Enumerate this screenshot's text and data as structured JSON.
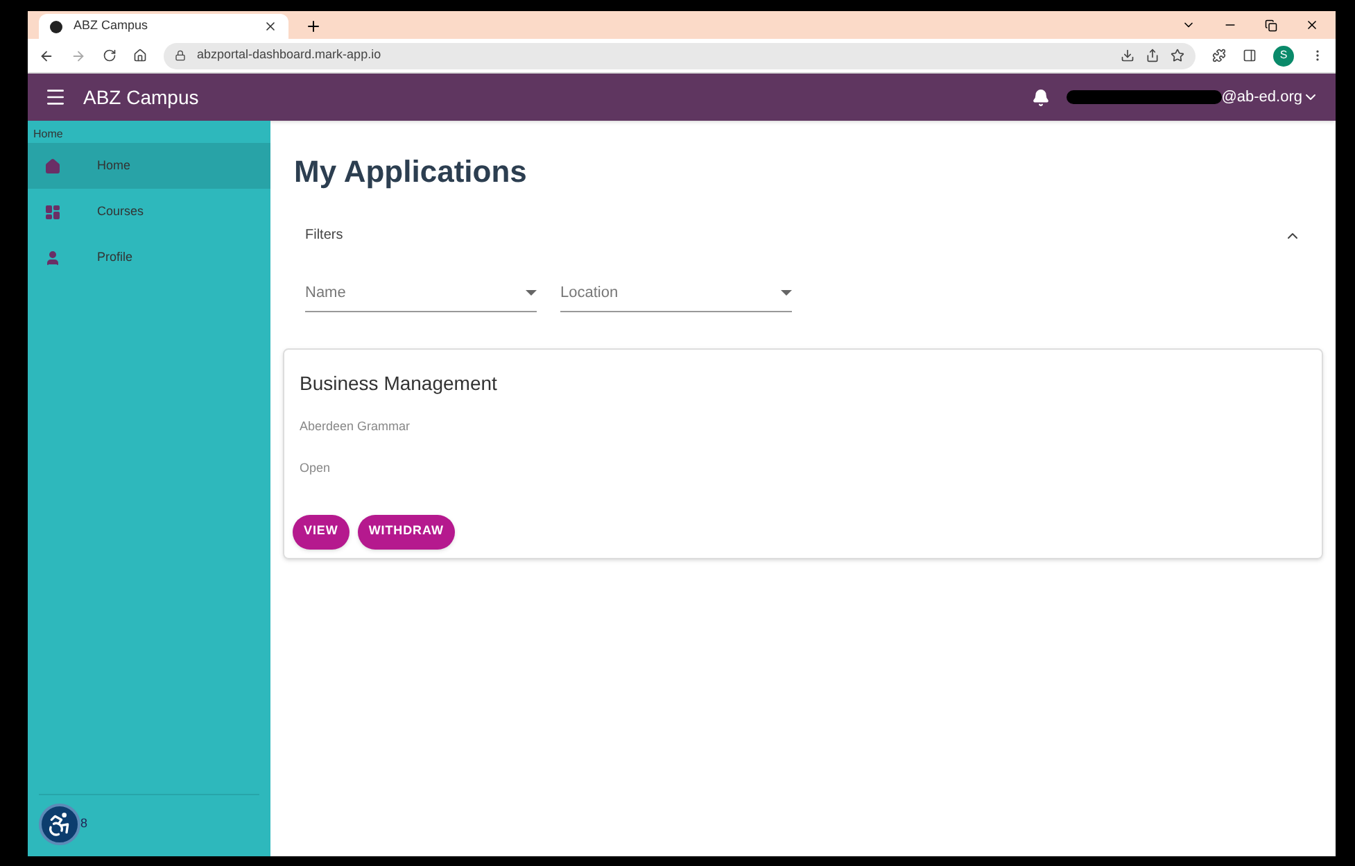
{
  "browser": {
    "tab_title": "ABZ Campus",
    "url": "abzportal-dashboard.mark-app.io",
    "profile_initial": "S"
  },
  "app_bar": {
    "title": "ABZ Campus",
    "user_email": "@ab-ed.org"
  },
  "sidebar": {
    "breadcrumb": "Home",
    "items": [
      {
        "label": "Home",
        "selected": true
      },
      {
        "label": "Courses",
        "selected": false
      },
      {
        "label": "Profile",
        "selected": false
      }
    ],
    "footer_text": "8"
  },
  "page_title": "My Applications",
  "filters": {
    "title": "Filters",
    "expanded": true,
    "fields": [
      {
        "placeholder": "Name"
      },
      {
        "placeholder": "Location"
      }
    ]
  },
  "applications": [
    {
      "course": "Business Management",
      "school": "Aberdeen Grammar",
      "status": "Open",
      "buttons": [
        "VIEW",
        "WITHDRAW"
      ]
    }
  ]
}
